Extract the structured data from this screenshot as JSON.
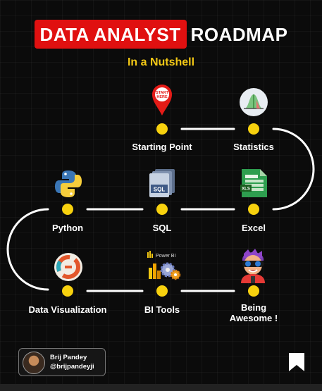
{
  "header": {
    "title_highlight": "DATA ANALYST",
    "title_rest": "ROADMAP",
    "subtitle": "In a Nutshell"
  },
  "colors": {
    "accent_red": "#e01010",
    "accent_yellow": "#f4c915",
    "dot_yellow": "#f7d10e",
    "track_white": "#ffffff",
    "background": "#0b0b0b"
  },
  "steps": [
    {
      "label": "Starting Point",
      "icon": "start-pin-icon"
    },
    {
      "label": "Statistics",
      "icon": "statistics-chart-icon"
    },
    {
      "label": "Excel",
      "icon": "excel-file-icon"
    },
    {
      "label": "SQL",
      "icon": "sql-file-icon"
    },
    {
      "label": "Python",
      "icon": "python-logo-icon"
    },
    {
      "label": "Data Visualization",
      "icon": "data-visualization-icon"
    },
    {
      "label": "BI Tools",
      "icon": "power-bi-icon"
    },
    {
      "label": "Being Awesome !",
      "icon": "avatar-character-icon"
    }
  ],
  "pin_text": "START HERE",
  "powerbi_text": "Power BI",
  "author": {
    "name": "Brij Pandey",
    "handle": "@brijpandeyji"
  },
  "footer_icon": "bookmark-icon"
}
